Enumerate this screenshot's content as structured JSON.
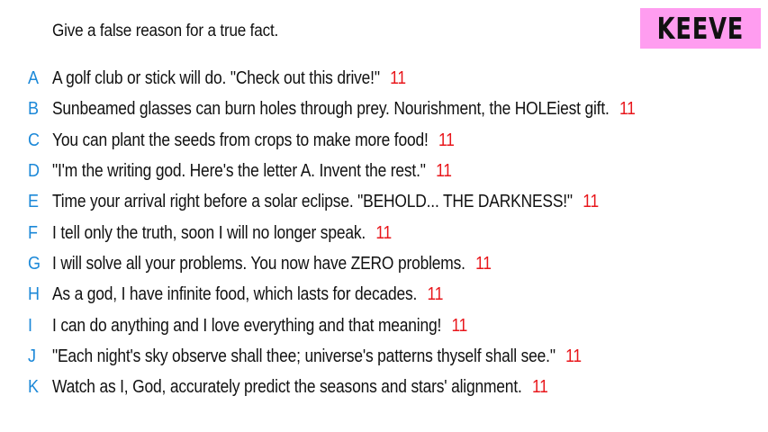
{
  "prompt": "Give a false reason for a true fact.",
  "player": {
    "name": "KEEVE"
  },
  "colors": {
    "letter": "#1b88d8",
    "votes": "#e8161b",
    "badge": "#ff9df0",
    "text": "#111111"
  },
  "answers": [
    {
      "letter": "A",
      "text": "A golf club or stick will do. \"Check out this drive!\"",
      "votes": "11"
    },
    {
      "letter": "B",
      "text": "Sunbeamed glasses can burn holes through prey. Nourishment, the HOLEiest gift.",
      "votes": "11"
    },
    {
      "letter": "C",
      "text": "You can plant the seeds from crops to make more food!",
      "votes": "11"
    },
    {
      "letter": "D",
      "text": "\"I'm the writing god. Here's the letter A. Invent the rest.\"",
      "votes": "11"
    },
    {
      "letter": "E",
      "text": "Time your arrival right before a solar eclipse. \"BEHOLD... THE DARKNESS!\"",
      "votes": "11"
    },
    {
      "letter": "F",
      "text": "I tell only the truth, soon I will no longer speak.",
      "votes": "11"
    },
    {
      "letter": "G",
      "text": "I will solve all your problems. You now have ZERO problems.",
      "votes": "11"
    },
    {
      "letter": "H",
      "text": "As a god, I have infinite food, which lasts for decades.",
      "votes": "11"
    },
    {
      "letter": "I",
      "text": "I can do anything and I love everything and that meaning!",
      "votes": "11"
    },
    {
      "letter": "J",
      "text": "\"Each night's sky observe shall thee; universe's patterns thyself shall see.\"",
      "votes": "11"
    },
    {
      "letter": "K",
      "text": "Watch as I, God, accurately predict the seasons and stars' alignment.",
      "votes": "11"
    }
  ]
}
